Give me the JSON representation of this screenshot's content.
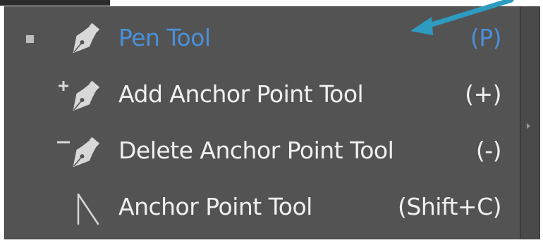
{
  "menu": {
    "items": [
      {
        "label": "Pen Tool",
        "shortcut": "(P)",
        "icon": "pen-icon",
        "selected": true
      },
      {
        "label": "Add Anchor Point Tool",
        "shortcut": "(+)",
        "icon": "add-anchor-point-icon",
        "selected": false
      },
      {
        "label": "Delete Anchor Point Tool",
        "shortcut": "(-)",
        "icon": "delete-anchor-point-icon",
        "selected": false
      },
      {
        "label": "Anchor Point Tool",
        "shortcut": "(Shift+C)",
        "icon": "anchor-point-icon",
        "selected": false
      }
    ]
  },
  "colors": {
    "panel_bg": "#535353",
    "text": "#f0f0f0",
    "active_text": "#4a90d9",
    "annotation_arrow": "#2e9bc0"
  }
}
